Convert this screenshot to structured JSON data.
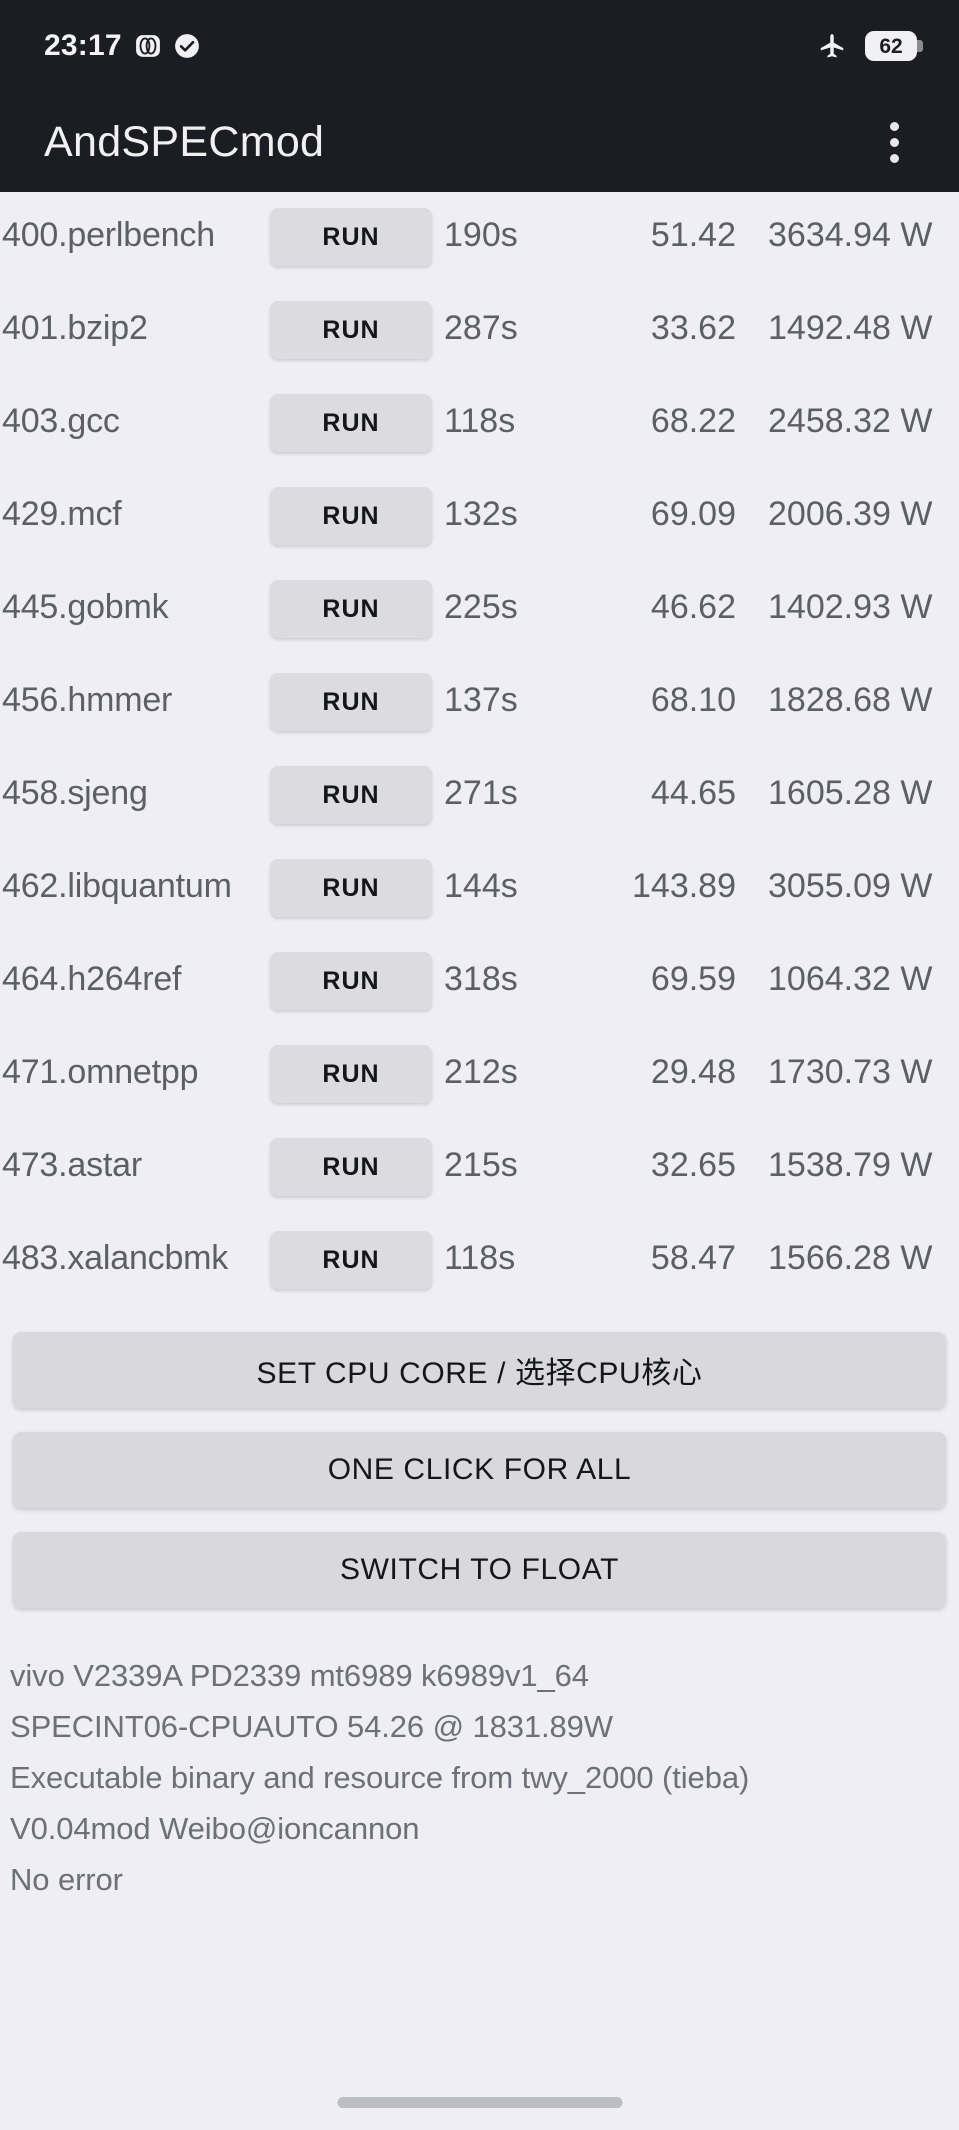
{
  "statusbar": {
    "clock": "23:17",
    "icons": [
      "dual-sim-icon",
      "check-circle-icon"
    ],
    "airplane_icon": "airplane-mode-icon",
    "battery_level": "62"
  },
  "appbar": {
    "title": "AndSPECmod",
    "overflow_icon": "overflow-menu-icon"
  },
  "table": {
    "run_label": "RUN",
    "rows": [
      {
        "name": "400.perlbench",
        "time": "190s",
        "score": "51.42",
        "power": "3634.94 W"
      },
      {
        "name": "401.bzip2",
        "time": "287s",
        "score": "33.62",
        "power": "1492.48 W"
      },
      {
        "name": "403.gcc",
        "time": "118s",
        "score": "68.22",
        "power": "2458.32 W"
      },
      {
        "name": "429.mcf",
        "time": "132s",
        "score": "69.09",
        "power": "2006.39 W"
      },
      {
        "name": "445.gobmk",
        "time": "225s",
        "score": "46.62",
        "power": "1402.93 W"
      },
      {
        "name": "456.hmmer",
        "time": "137s",
        "score": "68.10",
        "power": "1828.68 W"
      },
      {
        "name": "458.sjeng",
        "time": "271s",
        "score": "44.65",
        "power": "1605.28 W"
      },
      {
        "name": "462.libquantum",
        "time": "144s",
        "score": "143.89",
        "power": "3055.09 W"
      },
      {
        "name": "464.h264ref",
        "time": "318s",
        "score": "69.59",
        "power": "1064.32 W"
      },
      {
        "name": "471.omnetpp",
        "time": "212s",
        "score": "29.48",
        "power": "1730.73 W"
      },
      {
        "name": "473.astar",
        "time": "215s",
        "score": "32.65",
        "power": "1538.79 W"
      },
      {
        "name": "483.xalancbmk",
        "time": "118s",
        "score": "58.47",
        "power": "1566.28 W"
      }
    ]
  },
  "actions": {
    "set_cpu_core": "SET CPU CORE / 选择CPU核心",
    "one_click_for_all": "ONE CLICK FOR ALL",
    "switch_to_float": "SWITCH TO FLOAT"
  },
  "footer": {
    "line1": "vivo V2339A PD2339 mt6989 k6989v1_64",
    "line2": "SPECINT06-CPUAUTO  54.26 @ 1831.89W",
    "line3": "Executable binary and resource from twy_2000 (tieba)",
    "line4": "V0.04mod  Weibo@ioncannon",
    "line5": "No error"
  },
  "colors": {
    "appbar_bg": "#1b1d22",
    "page_bg": "#eeeef4",
    "button_bg": "#d9d9dd",
    "text_muted": "#5d5f66"
  }
}
